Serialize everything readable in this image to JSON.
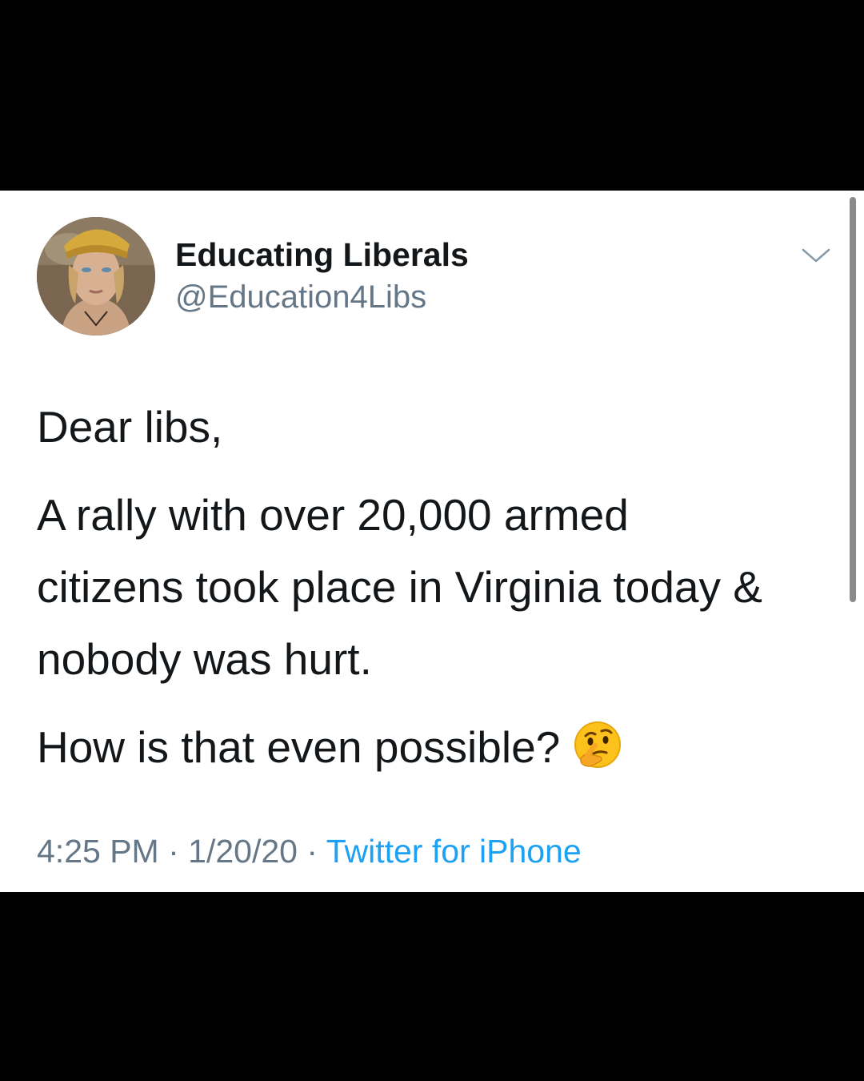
{
  "tweet": {
    "author": {
      "display_name": "Educating Liberals",
      "handle": "@Education4Libs",
      "avatar_icon": "profile-photo"
    },
    "menu_icon": "chevron-down-icon",
    "paragraphs": [
      "Dear libs,",
      "A rally with over 20,000 armed",
      "citizens took place in Virginia today &",
      "nobody was hurt.",
      "How is that even possible?"
    ],
    "emoji": "thinking-face-emoji",
    "time": "4:25 PM",
    "date": "1/20/20",
    "separator": "·",
    "source": "Twitter for iPhone"
  },
  "colors": {
    "text_primary": "#14171a",
    "text_secondary": "#657786",
    "link": "#1da1f2",
    "letterbox": "#000000",
    "card_background": "#ffffff"
  }
}
